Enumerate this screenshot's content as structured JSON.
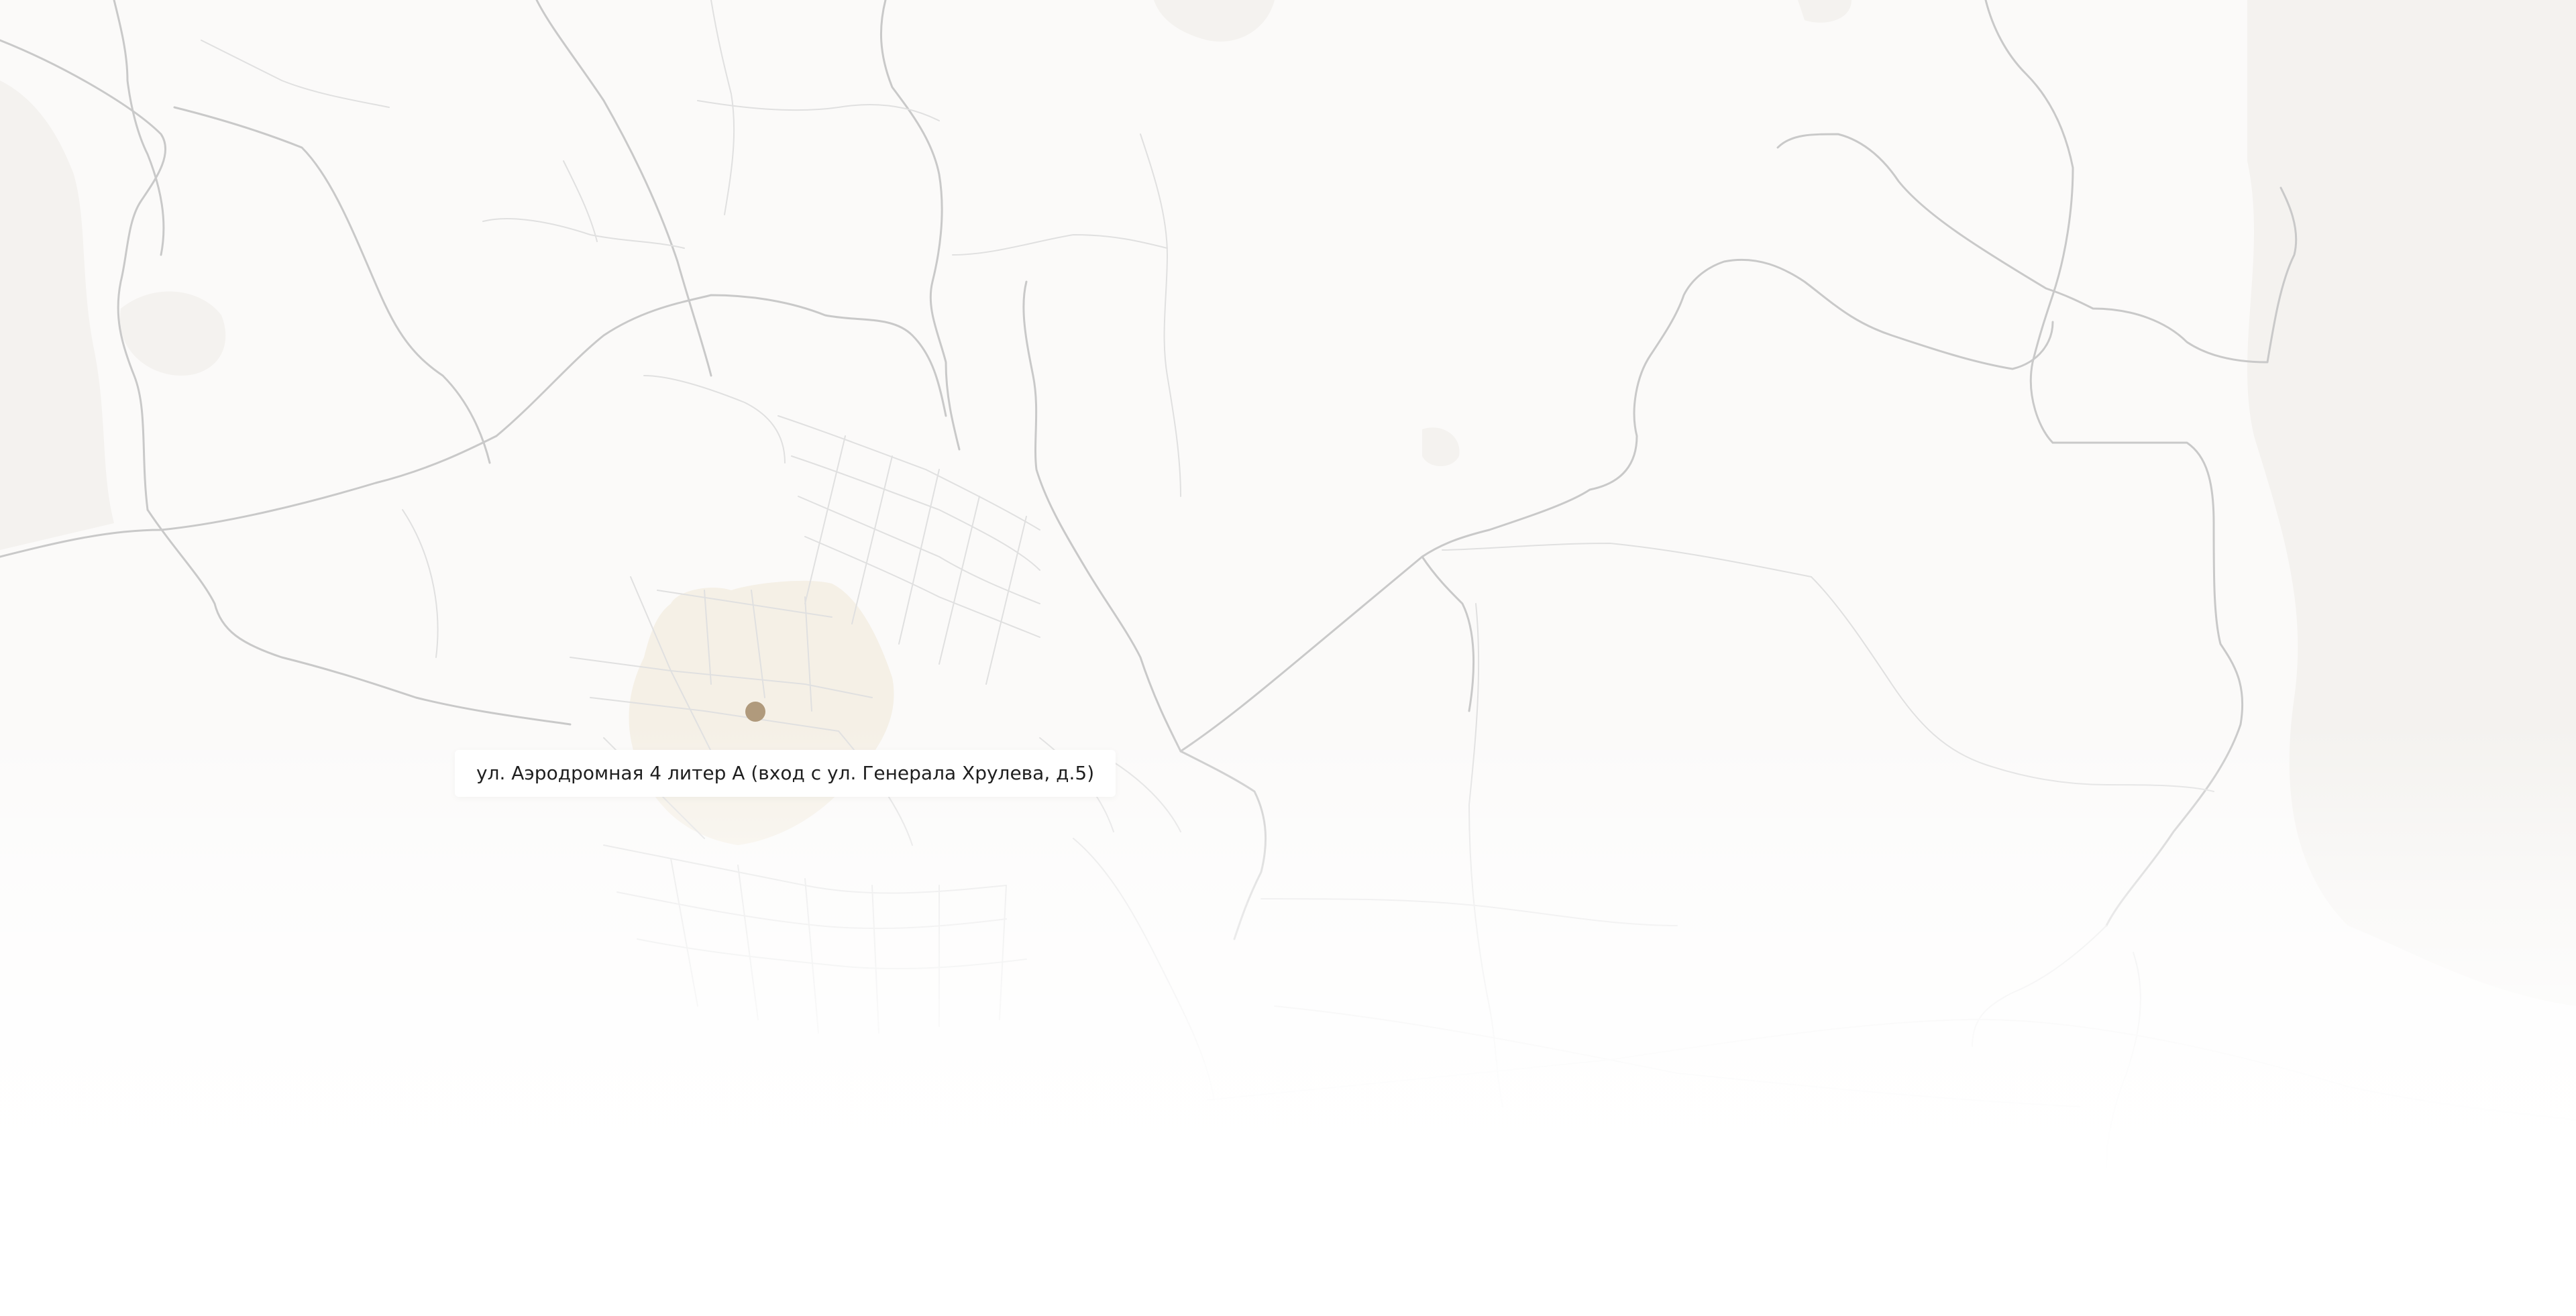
{
  "map": {
    "address": "ул. Аэродромная 4 литер А (вход с ул. Генерала Хрулева, д.5)",
    "colors": {
      "background": "#fbfaf9",
      "water": "#f3f1ee",
      "road_major": "#c8c8c8",
      "road_minor": "#e2e2e2",
      "highlight_area": "#f1ebe0",
      "marker": "#b09a7c",
      "label_background": "#ffffff",
      "label_text": "#1f1f1f"
    },
    "marker_icon": "location-dot-icon"
  }
}
